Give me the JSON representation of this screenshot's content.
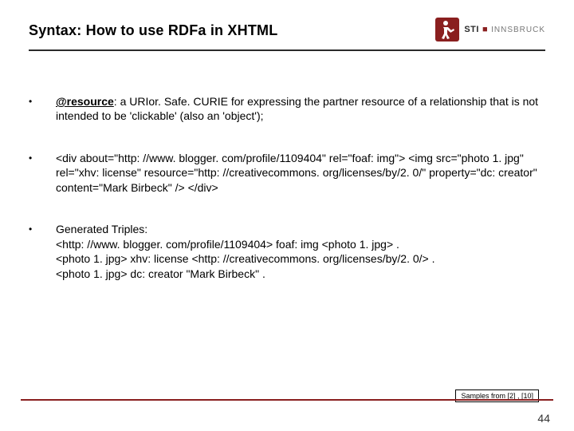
{
  "header": {
    "title": "Syntax: How to use RDFa in XHTML",
    "logo": {
      "sti": "STI",
      "city": "INNSBRUCK"
    }
  },
  "bullets": [
    {
      "attr": "@resource",
      "rest": ": a URIor. Safe. CURIE for expressing the partner resource of a relationship that is not intended to be 'clickable' (also an 'object');"
    },
    {
      "text": "<div about=\"http: //www. blogger. com/profile/1109404\" rel=\"foaf: img\"> <img src=\"photo 1. jpg\" rel=\"xhv: license\" resource=\"http: //creativecommons. org/licenses/by/2. 0/\" property=\"dc: creator\" content=\"Mark Birbeck\" /> </div>"
    },
    {
      "text": "Generated Triples:\n<http: //www. blogger. com/profile/1109404> foaf: img <photo 1. jpg> .\n<photo 1. jpg> xhv: license <http: //creativecommons. org/licenses/by/2. 0/> .\n<photo 1. jpg> dc: creator \"Mark Birbeck\" ."
    }
  ],
  "footer": {
    "samples": "Samples from [2] , [10]",
    "page": "44"
  }
}
